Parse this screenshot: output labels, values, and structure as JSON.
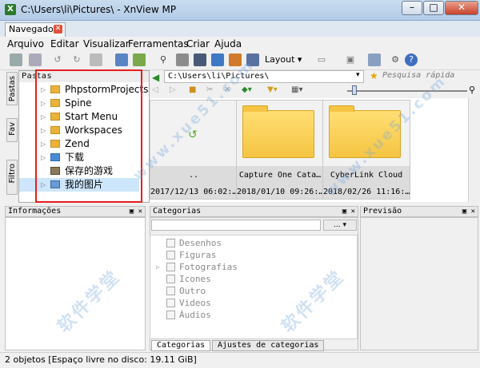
{
  "window": {
    "title": "C:\\Users\\li\\Pictures\\ - XnView MP",
    "app_icon": "xnview-icon"
  },
  "tabs": [
    {
      "label": "Navegador"
    }
  ],
  "menu": [
    "Arquivo",
    "Editar",
    "Visualizar",
    "Ferramentas",
    "Criar",
    "Ajuda"
  ],
  "toolbar": {
    "layout_label": "Layout"
  },
  "side_tabs": [
    "Pastas",
    "Fav",
    "Filtro"
  ],
  "folders": {
    "header": "Pastas",
    "items": [
      {
        "label": "PhpstormProjects",
        "expandable": true
      },
      {
        "label": "Spine",
        "expandable": true
      },
      {
        "label": "Start Menu",
        "expandable": true
      },
      {
        "label": "Workspaces",
        "expandable": true
      },
      {
        "label": "Zend",
        "expandable": true
      },
      {
        "label": "下载",
        "expandable": true
      },
      {
        "label": "保存的游戏",
        "expandable": false
      },
      {
        "label": "我的图片",
        "expandable": true
      }
    ]
  },
  "address": {
    "path": "C:\\Users\\li\\Pictures\\",
    "search_placeholder": "Pesquisa rápida"
  },
  "thumbnails": [
    {
      "name": "..",
      "date": "2017/12/13 06:02:…",
      "kind": "up"
    },
    {
      "name": "Capture One Cata…",
      "date": "2018/01/10 09:26:…",
      "kind": "folder"
    },
    {
      "name": "CyberLink Cloud",
      "date": "2018/02/26 11:16:…",
      "kind": "folder"
    }
  ],
  "panels": {
    "info": "Informações",
    "categories": "Categorias",
    "preview": "Previsão"
  },
  "categories": {
    "dropdown_label": "...",
    "items": [
      {
        "label": "Desenhos",
        "expandable": false
      },
      {
        "label": "Figuras",
        "expandable": false
      },
      {
        "label": "Fotografias",
        "expandable": true
      },
      {
        "label": "Icones",
        "expandable": false
      },
      {
        "label": "Outro",
        "expandable": false
      },
      {
        "label": "Videos",
        "expandable": false
      },
      {
        "label": "Áudios",
        "expandable": false
      }
    ],
    "bottom_tabs": [
      "Categorias",
      "Ajustes de categorias"
    ]
  },
  "status": "2 objetos [Espaço livre no disco: 19.11 GiB]",
  "watermark": [
    "www.xue51.com",
    "软件学堂"
  ],
  "colors": {
    "highlight": "#e81c1c",
    "folder": "#f5c543",
    "titlebar": "#c9dcef"
  }
}
